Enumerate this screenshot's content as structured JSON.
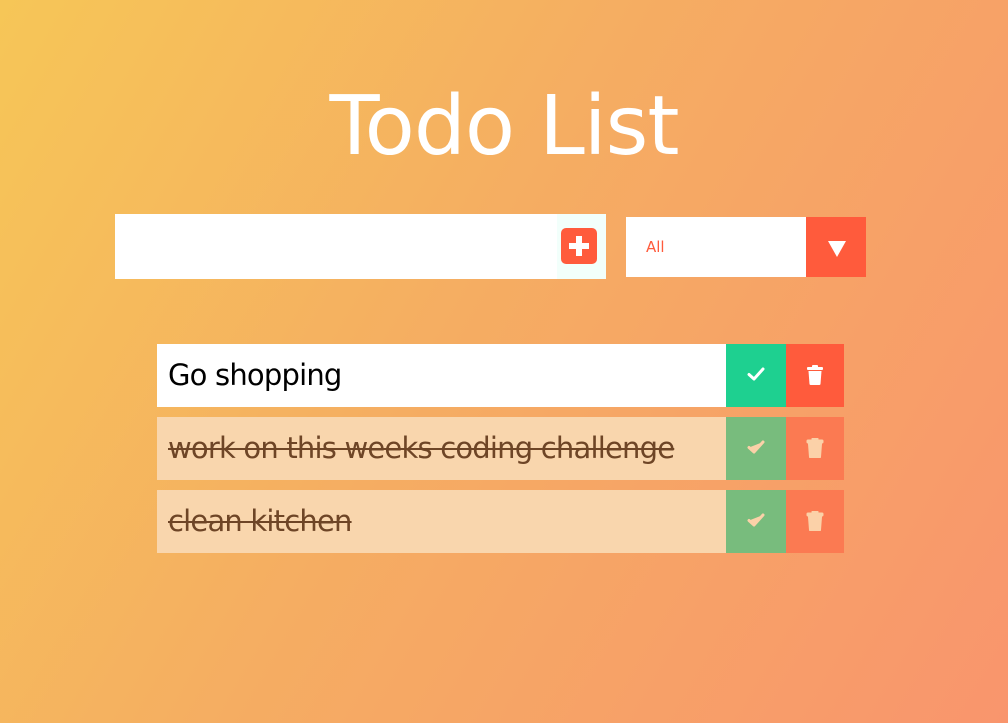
{
  "header": {
    "title": "Todo List"
  },
  "form": {
    "input_value": "",
    "input_placeholder": "",
    "add_icon": "plus-square-icon",
    "filter": {
      "selected": "All",
      "icon": "dropdown-arrow-icon"
    }
  },
  "todos": [
    {
      "text": "Go shopping",
      "completed": false
    },
    {
      "text": "work on this weeks coding challenge",
      "completed": true
    },
    {
      "text": "clean kitchen",
      "completed": true
    }
  ],
  "item_icons": {
    "complete": "check-icon",
    "delete": "trash-icon"
  },
  "colors": {
    "accent": "#ff5b3c",
    "complete": "#1ed090",
    "complete_done": "#78bc7d",
    "gradient_start": "#f6c657",
    "gradient_end": "#f9956d"
  }
}
